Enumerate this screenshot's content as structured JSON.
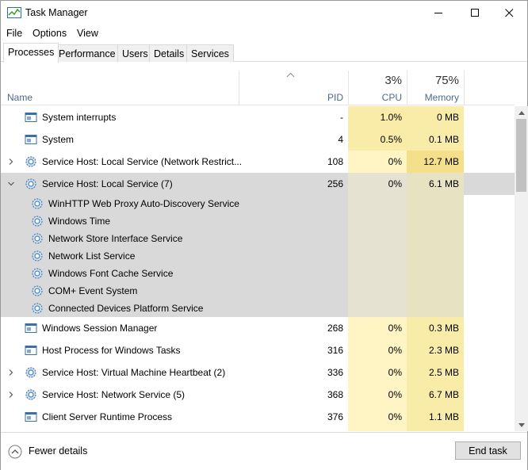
{
  "window": {
    "title": "Task Manager",
    "minimize_icon": "minimize-icon",
    "maximize_icon": "maximize-icon",
    "close_icon": "close-icon"
  },
  "menu": [
    "File",
    "Options",
    "View"
  ],
  "tabs": [
    {
      "label": "Processes",
      "active": true
    },
    {
      "label": "Performance",
      "active": false
    },
    {
      "label": "Users",
      "active": false
    },
    {
      "label": "Details",
      "active": false
    },
    {
      "label": "Services",
      "active": false
    }
  ],
  "columns": {
    "name": "Name",
    "pid": "PID",
    "cpu_pct": "3%",
    "cpu": "CPU",
    "memory_pct": "75%",
    "memory": "Memory"
  },
  "colors": {
    "heat_light": "#fff4c4",
    "heat_mid": "#f9eca8",
    "selected_group": "#d9d9d9",
    "header_text": "#4d6a8a"
  },
  "rows": [
    {
      "name": "System interrupts",
      "pid": "-",
      "cpu": "1.0%",
      "memory": "0 MB",
      "icon": "window-icon",
      "expandable": false
    },
    {
      "name": "System",
      "pid": "4",
      "cpu": "0.5%",
      "memory": "0.1 MB",
      "icon": "window-icon",
      "expandable": false
    },
    {
      "name": "Service Host: Local Service (Network Restrict...",
      "pid": "108",
      "cpu": "0%",
      "memory": "12.7 MB",
      "icon": "gear-icon",
      "expandable": true
    },
    {
      "name": "Service Host: Local Service (7)",
      "pid": "256",
      "cpu": "0%",
      "memory": "6.1 MB",
      "icon": "gear-icon",
      "expandable": true,
      "expanded": true
    },
    {
      "name": "Windows Session Manager",
      "pid": "268",
      "cpu": "0%",
      "memory": "0.3 MB",
      "icon": "window-icon",
      "expandable": false
    },
    {
      "name": "Host Process for Windows Tasks",
      "pid": "316",
      "cpu": "0%",
      "memory": "2.3 MB",
      "icon": "window-icon",
      "expandable": false
    },
    {
      "name": "Service Host: Virtual Machine Heartbeat (2)",
      "pid": "336",
      "cpu": "0%",
      "memory": "2.5 MB",
      "icon": "gear-icon",
      "expandable": true
    },
    {
      "name": "Service Host: Network Service (5)",
      "pid": "368",
      "cpu": "0%",
      "memory": "6.7 MB",
      "icon": "gear-icon",
      "expandable": true
    },
    {
      "name": "Client Server Runtime Process",
      "pid": "376",
      "cpu": "0%",
      "memory": "1.1 MB",
      "icon": "window-icon",
      "expandable": false
    }
  ],
  "sub_services": [
    "WinHTTP Web Proxy Auto-Discovery Service",
    "Windows Time",
    "Network Store Interface Service",
    "Network List Service",
    "Windows Font Cache Service",
    "COM+ Event System",
    "Connected Devices Platform Service"
  ],
  "footer": {
    "fewer_details": "Fewer details",
    "end_task": "End task"
  }
}
